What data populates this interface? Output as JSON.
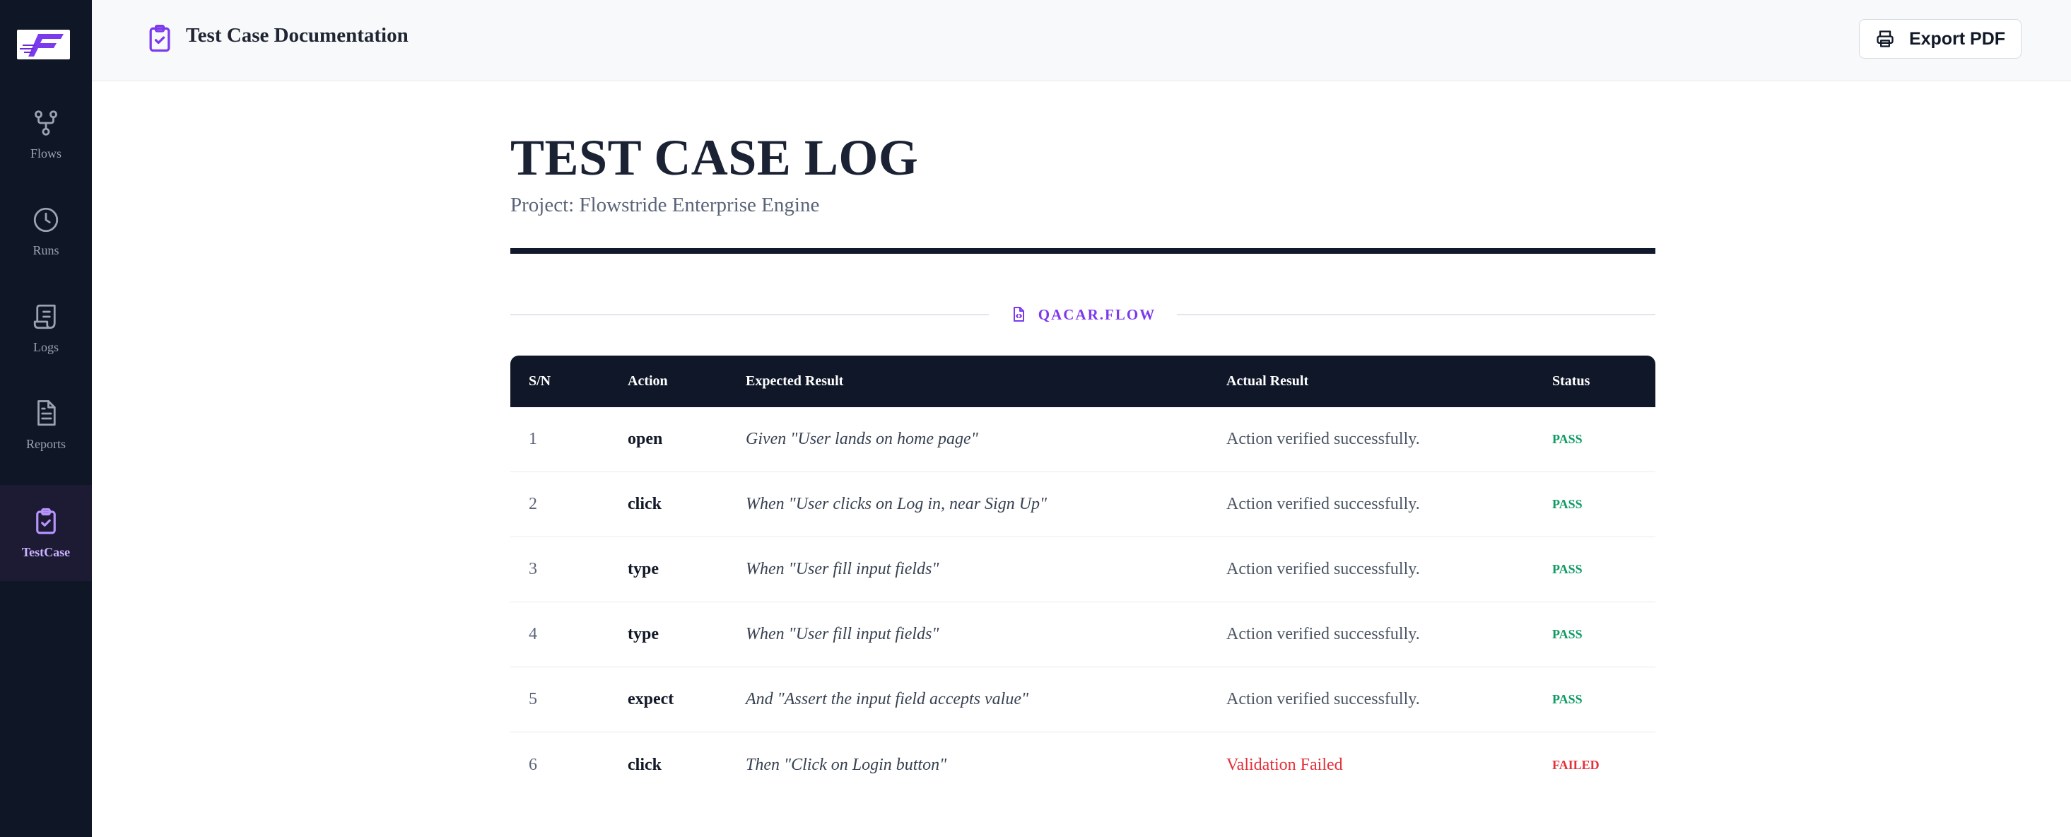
{
  "header": {
    "title": "Test Case Documentation",
    "export_label": "Export PDF"
  },
  "sidebar": {
    "items": [
      {
        "label": "Flows",
        "icon": "git-branch-icon"
      },
      {
        "label": "Runs",
        "icon": "clock-icon"
      },
      {
        "label": "Logs",
        "icon": "scroll-icon"
      },
      {
        "label": "Reports",
        "icon": "document-icon"
      },
      {
        "label": "TestCase",
        "icon": "clipboard-check-icon",
        "active": true
      }
    ]
  },
  "document": {
    "title": "TEST CASE LOG",
    "subtitle": "Project: Flowstride Enterprise Engine",
    "section": "QACAR.FLOW"
  },
  "table": {
    "headers": [
      "S/N",
      "Action",
      "Expected Result",
      "Actual Result",
      "Status"
    ],
    "rows": [
      {
        "sn": "1",
        "action": "open",
        "expected": "Given \"User lands on home page\"",
        "actual": "Action verified successfully.",
        "status": "PASS"
      },
      {
        "sn": "2",
        "action": "click",
        "expected": "When \"User clicks on Log in, near Sign Up\"",
        "actual": "Action verified successfully.",
        "status": "PASS"
      },
      {
        "sn": "3",
        "action": "type",
        "expected": "When \"User fill input fields\"",
        "actual": "Action verified successfully.",
        "status": "PASS"
      },
      {
        "sn": "4",
        "action": "type",
        "expected": "When \"User fill input fields\"",
        "actual": "Action verified successfully.",
        "status": "PASS"
      },
      {
        "sn": "5",
        "action": "expect",
        "expected": "And \"Assert the input field accepts value\"",
        "actual": "Action verified successfully.",
        "status": "PASS"
      },
      {
        "sn": "6",
        "action": "click",
        "expected": "Then \"Click on Login button\"",
        "actual": "Validation Failed",
        "status": "FAILED"
      }
    ]
  },
  "colors": {
    "sidebar_bg": "#0f1625",
    "accent": "#7c3aed",
    "pass": "#0f9a63",
    "fail": "#e5303a",
    "table_header_bg": "#0f1728"
  }
}
